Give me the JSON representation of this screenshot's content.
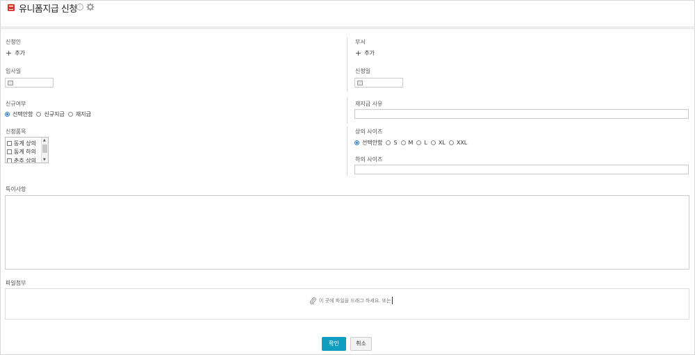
{
  "header": {
    "title": "유니폼지급 신청",
    "icon": "book-icon",
    "accent": "#d9342b"
  },
  "form": {
    "applicant": {
      "label": "신청인",
      "add_label": "추가"
    },
    "department": {
      "label": "부서",
      "add_label": "추가"
    },
    "join_date": {
      "label": "입사일",
      "value": ""
    },
    "apply_date": {
      "label": "신청일",
      "value": ""
    },
    "new_status": {
      "label": "신규여부",
      "options": [
        "선택안함",
        "신규지급",
        "재지급"
      ],
      "selected": "선택안함"
    },
    "reissue_reason": {
      "label": "재지급 사유",
      "value": ""
    },
    "apply_items": {
      "label": "신청품목",
      "items": [
        "동계 상의",
        "동계 하의",
        "춘추 상의"
      ]
    },
    "top_size": {
      "label": "상의 사이즈",
      "options": [
        "선택안함",
        "S",
        "M",
        "L",
        "XL",
        "XXL"
      ],
      "selected": "선택안함"
    },
    "bottom_size": {
      "label": "하의 사이즈",
      "value": ""
    },
    "notes": {
      "label": "특이사항",
      "value": ""
    },
    "attachment": {
      "label": "파일첨부",
      "drop_text": "이 곳에 파일을 드래그 하세요. 또는"
    }
  },
  "buttons": {
    "ok": "확인",
    "cancel": "취소"
  },
  "colors": {
    "primary": "#0f9ec0",
    "radio": "#2673c4"
  }
}
